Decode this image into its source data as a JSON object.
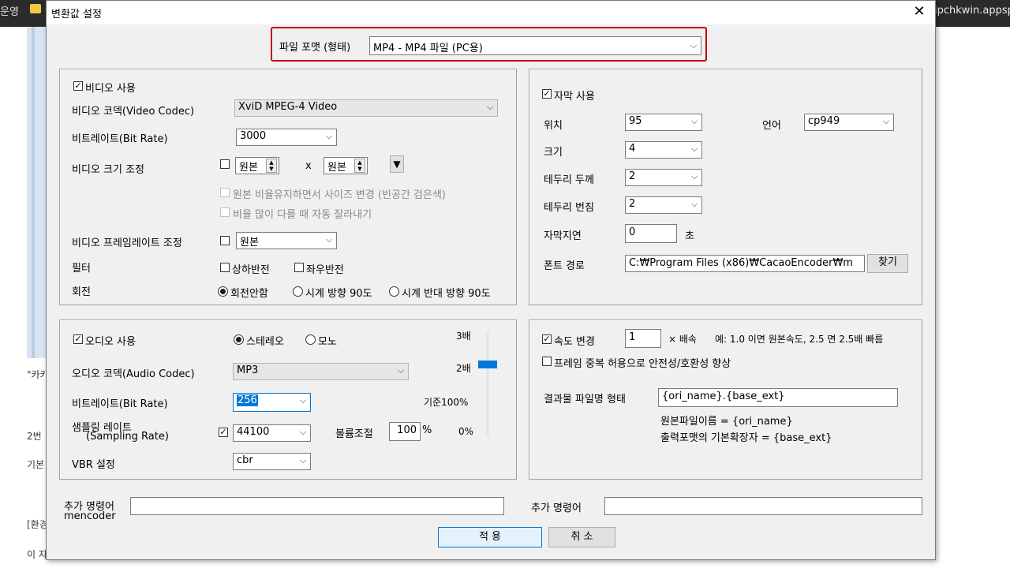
{
  "background": {
    "left_text": "운영",
    "right_text": "ipchkwin.appsp",
    "lines": [
      "\"카카",
      "2번",
      "기본",
      "[환경",
      "이 자"
    ]
  },
  "dialog": {
    "title": "변환값 설정",
    "close_glyph": "✕",
    "file_format": {
      "label": "파일 포맷 (형태)",
      "value": "MP4 - MP4 파일 (PC용)"
    },
    "video": {
      "enable_label": "비디오 사용",
      "codec_label": "비디오 코덱(Video Codec)",
      "codec_value": "XviD MPEG-4 Video",
      "bitrate_label": "비트레이트(Bit Rate)",
      "bitrate_value": "3000",
      "size_label": "비디오 크기 조정",
      "size_w": "원본",
      "size_x": "x",
      "size_h": "원본",
      "keep_ratio_label": "원본 비율유지하면서 사이즈 변경 (빈공간 검은색)",
      "auto_crop_label": "비율 많이 다를 때 자동 잘라내기",
      "framerate_label": "비디오 프레임레이트 조정",
      "framerate_value": "원본",
      "filter_label": "필터",
      "flip_v_label": "상하반전",
      "flip_h_label": "좌우반전",
      "rotate_label": "회전",
      "rotate_none": "회전안함",
      "rotate_cw": "시계 방향 90도",
      "rotate_ccw": "시계 반대 방향 90도"
    },
    "subtitle": {
      "enable_label": "자막 사용",
      "position_label": "위치",
      "position_value": "95",
      "language_label": "언어",
      "language_value": "cp949",
      "size_label": "크기",
      "size_value": "4",
      "border_width_label": "테두리 두께",
      "border_width_value": "2",
      "border_blur_label": "테두리 번짐",
      "border_blur_value": "2",
      "delay_label": "자막지연",
      "delay_value": "0",
      "delay_unit": "초",
      "font_path_label": "폰트 경로",
      "font_path_value": "C:₩Program Files (x86)₩CacaoEncoder₩m",
      "browse_label": "찾기"
    },
    "audio": {
      "enable_label": "오디오 사용",
      "stereo_label": "스테레오",
      "mono_label": "모노",
      "codec_label": "오디오 코덱(Audio Codec)",
      "codec_value": "MP3",
      "bitrate_label": "비트레이트(Bit Rate)",
      "bitrate_value": "256",
      "sampling_label_1": "샘플링 레이트",
      "sampling_label_2": "(Sampling Rate)",
      "sampling_value": "44100",
      "volume_label": "볼륨조절",
      "volume_value": "100",
      "volume_unit": "%",
      "vbr_label": "VBR 설정",
      "vbr_value": "cbr",
      "scale_3x": "3배",
      "scale_2x": "2배",
      "scale_base": "기준100%",
      "scale_0": "0%",
      "volume_level": 0.5
    },
    "speed": {
      "enable_label": "속도 변경",
      "value": "1",
      "unit": "× 배속",
      "example": "예: 1.0 이면 원본속도, 2.5 면 2.5배 빠름",
      "frame_dup_label": "프레임 중복 허용으로 안전성/호환성 향상",
      "output_name_label": "결과물 파일명 형태",
      "output_name_value": "{ori_name}.{base_ext}",
      "help_1": "원본파일이름 = {ori_name}",
      "help_2": "출력포맷의 기본확장자 = {base_ext}"
    },
    "extra": {
      "label_left_1": "추가 명령어",
      "label_left_2": "mencoder",
      "value_left": "",
      "label_right": "추가 명령어",
      "value_right": ""
    },
    "buttons": {
      "apply": "적 용",
      "cancel": "취 소"
    },
    "colors": {
      "highlight_border": "#c00000",
      "accent": "#0078d7"
    }
  }
}
